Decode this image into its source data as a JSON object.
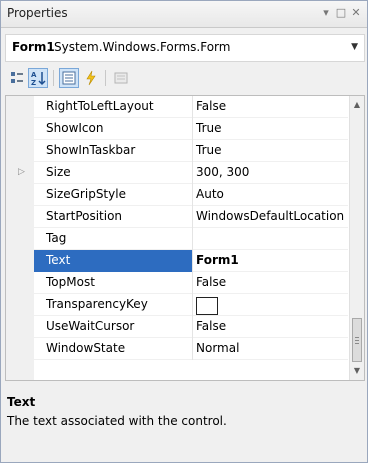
{
  "window": {
    "title": "Properties",
    "dropdown_glyph": "▾",
    "maximize_glyph": "□",
    "close_glyph": "✕"
  },
  "object_selector": {
    "name": "Form1",
    "type": "System.Windows.Forms.Form"
  },
  "toolbar": {
    "tools": [
      "categorized-icon",
      "alphabetical-icon",
      "properties-icon",
      "events-icon",
      "property-pages-icon"
    ],
    "pressed": "alphabetical-icon",
    "accent": "#2d6cc0"
  },
  "grid": {
    "rows": [
      {
        "name": "RightToLeftLayout",
        "value": "False"
      },
      {
        "name": "ShowIcon",
        "value": "True"
      },
      {
        "name": "ShowInTaskbar",
        "value": "True"
      },
      {
        "name": "Size",
        "value": "300, 300"
      },
      {
        "name": "SizeGripStyle",
        "value": "Auto"
      },
      {
        "name": "StartPosition",
        "value": "WindowsDefaultLocation"
      },
      {
        "name": "Tag",
        "value": ""
      },
      {
        "name": "Text",
        "value": "Form1"
      },
      {
        "name": "TopMost",
        "value": "False"
      },
      {
        "name": "TransparencyKey",
        "value": ""
      },
      {
        "name": "UseWaitCursor",
        "value": "False"
      },
      {
        "name": "WindowState",
        "value": "Normal"
      }
    ],
    "selected_row": "Text",
    "expandable_row": "Size",
    "swatch_row": "TransparencyKey",
    "scroll_position": 0.82
  },
  "description": {
    "title": "Text",
    "text": "The text associated with the control."
  }
}
